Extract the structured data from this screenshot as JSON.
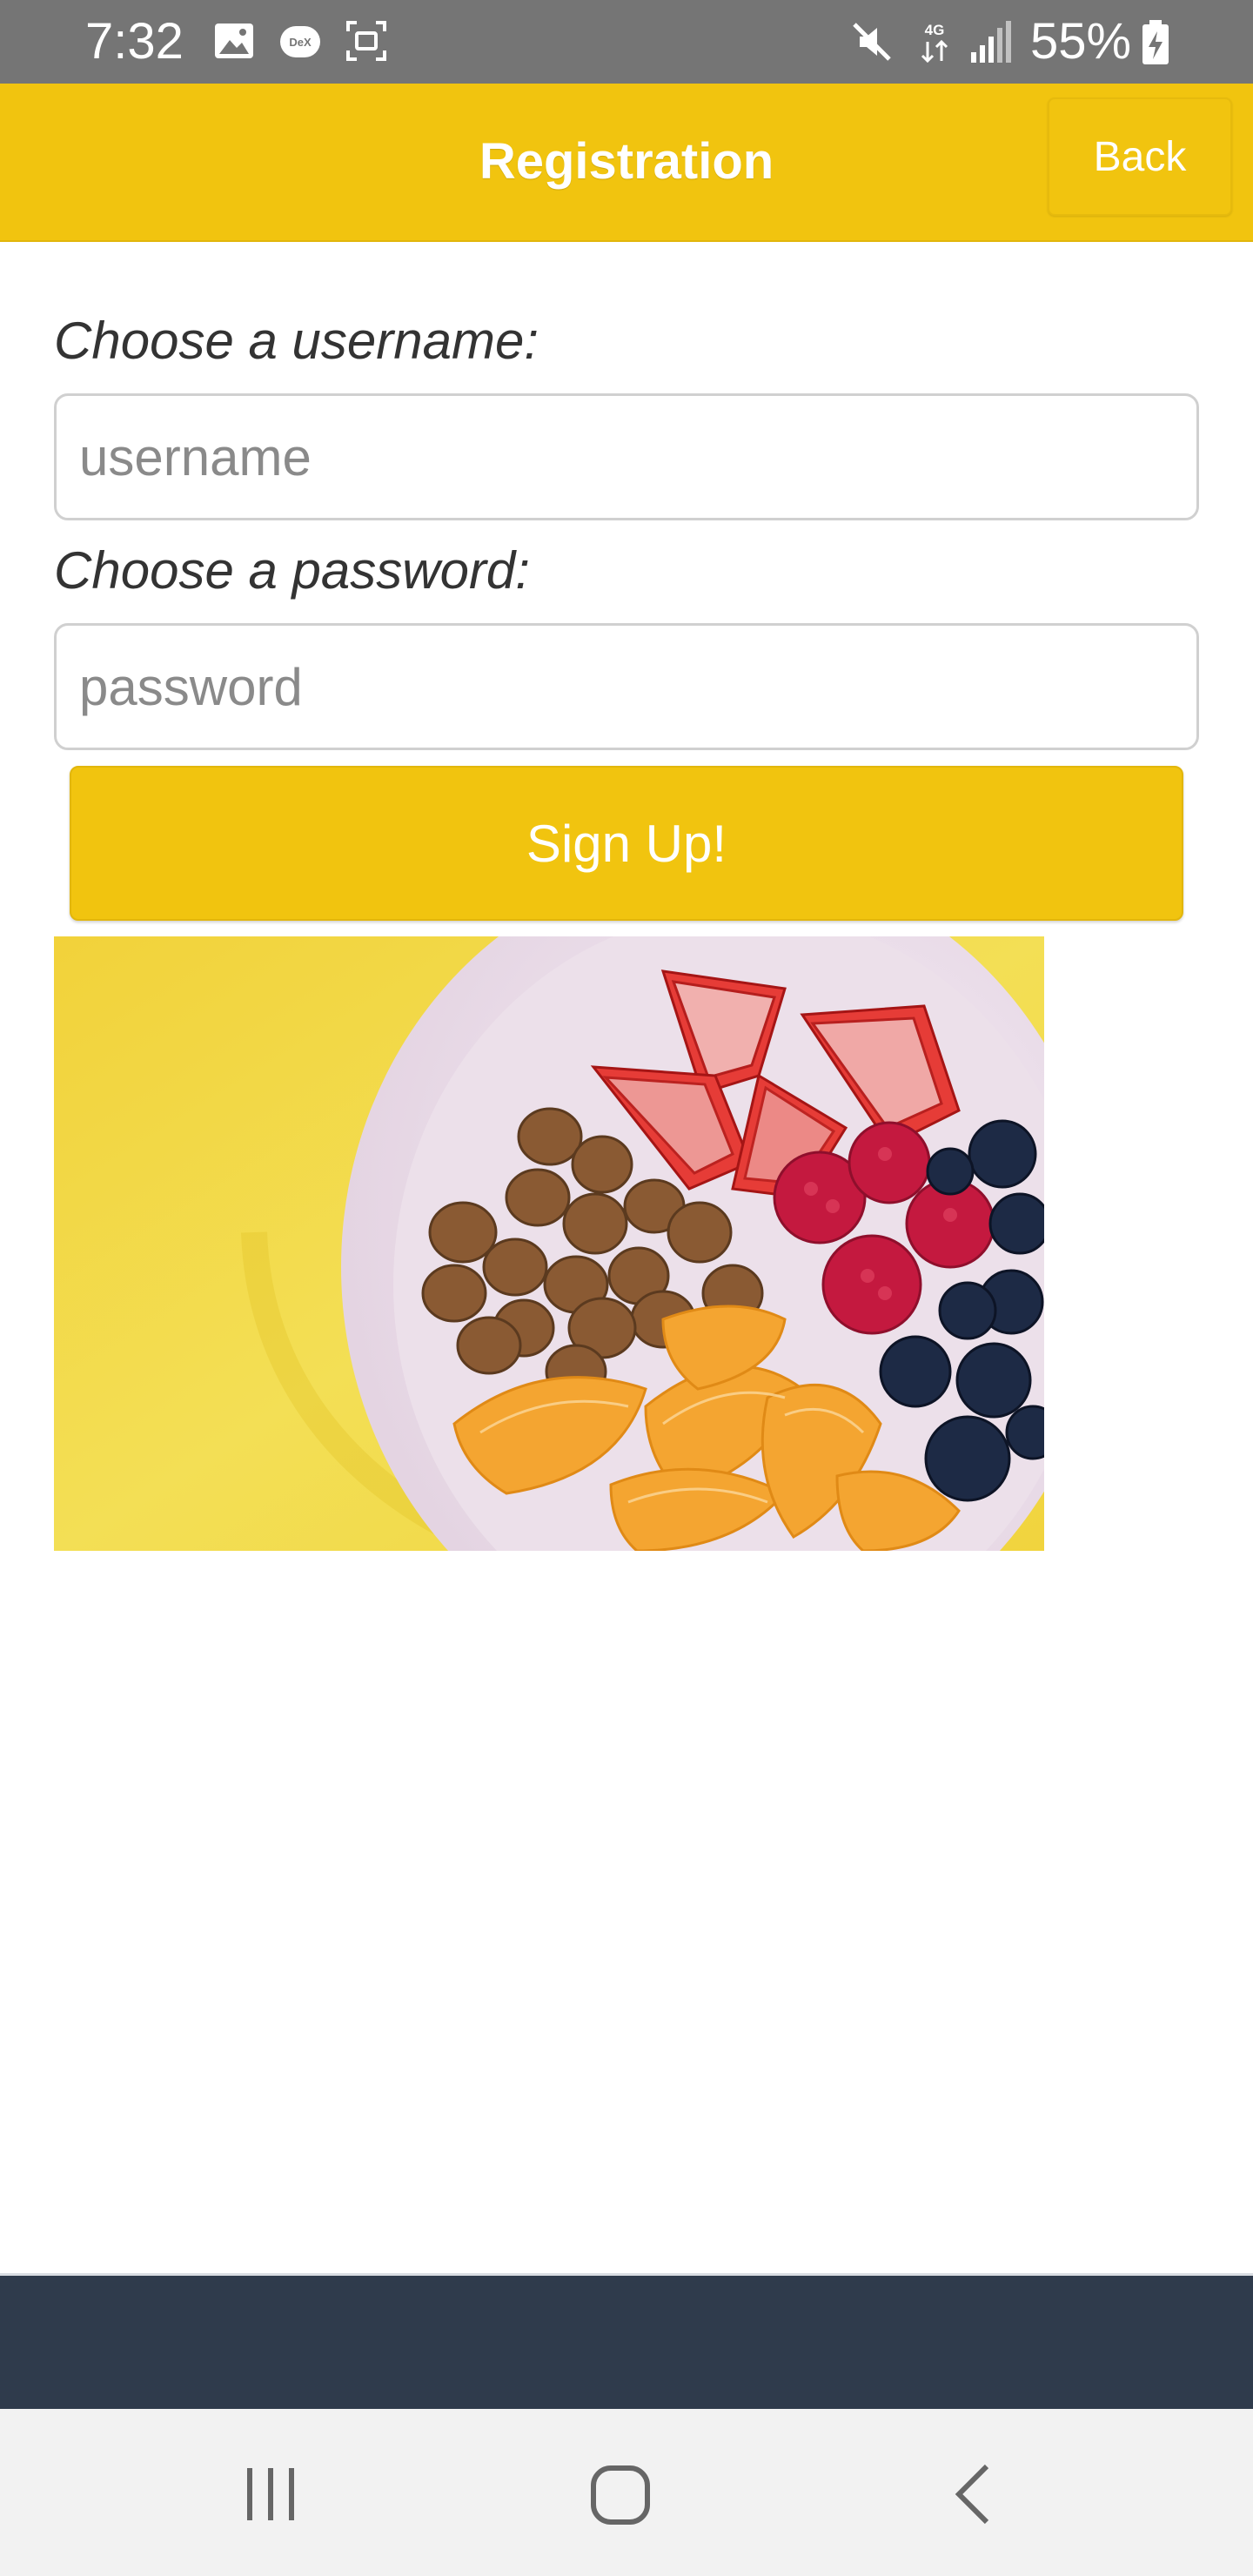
{
  "status_bar": {
    "time": "7:32",
    "battery": "55%",
    "icons": [
      "gallery-icon",
      "dex-icon",
      "screenshot-icon",
      "mute-icon",
      "lte-icon",
      "signal-icon",
      "battery-icon"
    ],
    "dex_label": "DeX",
    "lte_label": "4G"
  },
  "header": {
    "title": "Registration",
    "back_label": "Back"
  },
  "form": {
    "username_label": "Choose a username:",
    "username_placeholder": "username",
    "username_value": "",
    "password_label": "Choose a password:",
    "password_placeholder": "password",
    "password_value": "",
    "signup_label": "Sign Up!"
  },
  "image": {
    "description_icon": "fruit-bowl-image"
  },
  "nav_bar": {
    "icons": [
      "recent-apps-icon",
      "home-icon",
      "back-icon"
    ]
  },
  "colors": {
    "accent": "#f1c40f",
    "status_bar": "#757575",
    "footer": "#2f3b4c"
  }
}
